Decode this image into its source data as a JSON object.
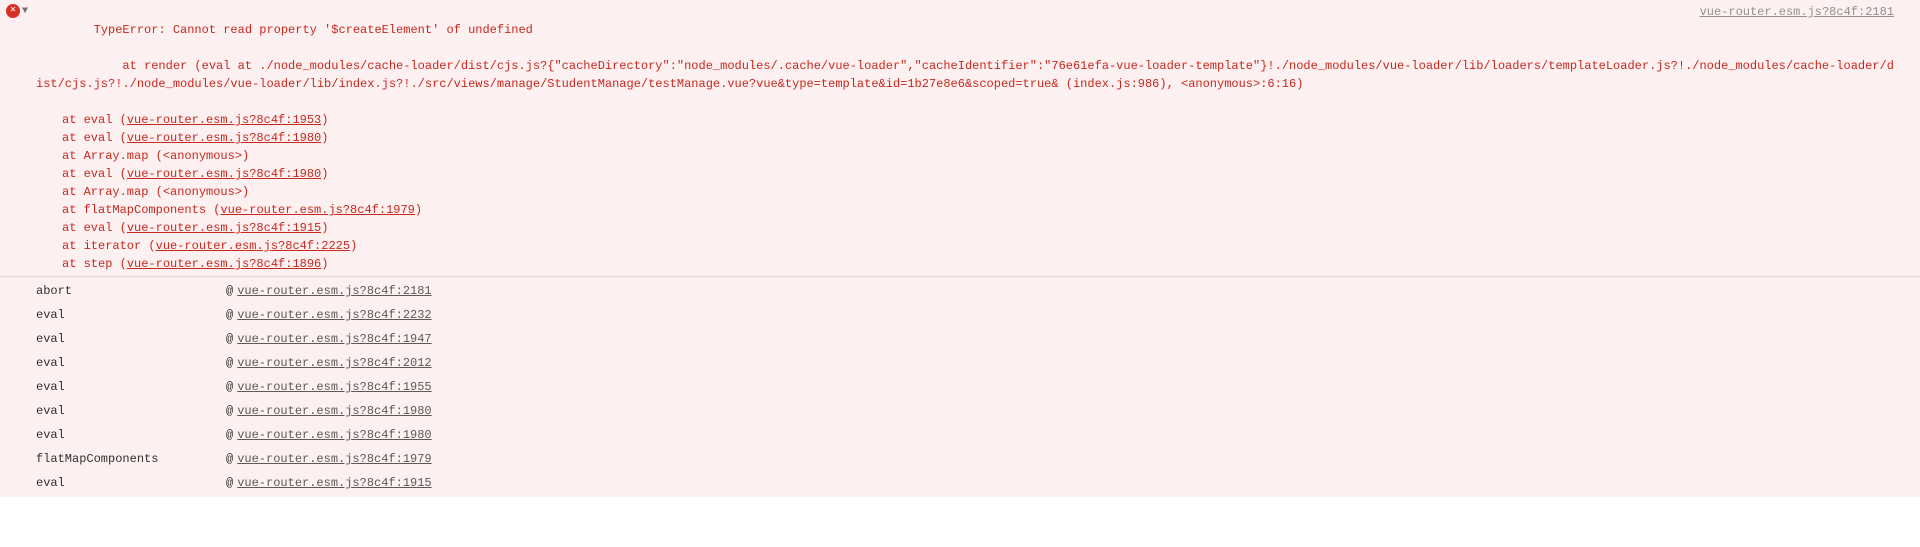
{
  "error": {
    "source_link": "vue-router.esm.js?8c4f:2181",
    "title": "TypeError: Cannot read property '$createElement' of undefined",
    "render_line_pre": "    at render (eval at ./node_modules/cache-loader/dist/cjs.js?{\"cacheDirectory\":\"node_modules/.cache/vue-loader\",\"cacheIdentifier\":\"76e61efa-vue-loader-template\"}!./node_modules/vue-loader/lib/loaders/templateLoader.js?!./node_modules/cache-loader/dist/cjs.js?!./node_modules/vue-loader/lib/index.js?!./src/views/manage/StudentManage/testManage.vue?vue&type=template&id=1b27e8e6&scoped=true& (",
    "render_line_link": "index.js:986",
    "render_line_post": "), <anonymous>:6:16)",
    "stack": [
      {
        "prefix": "at eval (",
        "link": "vue-router.esm.js?8c4f:1953",
        "suffix": ")"
      },
      {
        "prefix": "at eval (",
        "link": "vue-router.esm.js?8c4f:1980",
        "suffix": ")"
      },
      {
        "prefix": "at Array.map (<anonymous>)",
        "link": "",
        "suffix": ""
      },
      {
        "prefix": "at eval (",
        "link": "vue-router.esm.js?8c4f:1980",
        "suffix": ")"
      },
      {
        "prefix": "at Array.map (<anonymous>)",
        "link": "",
        "suffix": ""
      },
      {
        "prefix": "at flatMapComponents (",
        "link": "vue-router.esm.js?8c4f:1979",
        "suffix": ")"
      },
      {
        "prefix": "at eval (",
        "link": "vue-router.esm.js?8c4f:1915",
        "suffix": ")"
      },
      {
        "prefix": "at iterator (",
        "link": "vue-router.esm.js?8c4f:2225",
        "suffix": ")"
      },
      {
        "prefix": "at step (",
        "link": "vue-router.esm.js?8c4f:1896",
        "suffix": ")"
      }
    ]
  },
  "trace": [
    {
      "fn": "abort",
      "link": "vue-router.esm.js?8c4f:2181"
    },
    {
      "fn": "eval",
      "link": "vue-router.esm.js?8c4f:2232"
    },
    {
      "fn": "eval",
      "link": "vue-router.esm.js?8c4f:1947"
    },
    {
      "fn": "eval",
      "link": "vue-router.esm.js?8c4f:2012"
    },
    {
      "fn": "eval",
      "link": "vue-router.esm.js?8c4f:1955"
    },
    {
      "fn": "eval",
      "link": "vue-router.esm.js?8c4f:1980"
    },
    {
      "fn": "eval",
      "link": "vue-router.esm.js?8c4f:1980"
    },
    {
      "fn": "flatMapComponents",
      "link": "vue-router.esm.js?8c4f:1979"
    },
    {
      "fn": "eval",
      "link": "vue-router.esm.js?8c4f:1915"
    }
  ],
  "at_symbol": "@"
}
